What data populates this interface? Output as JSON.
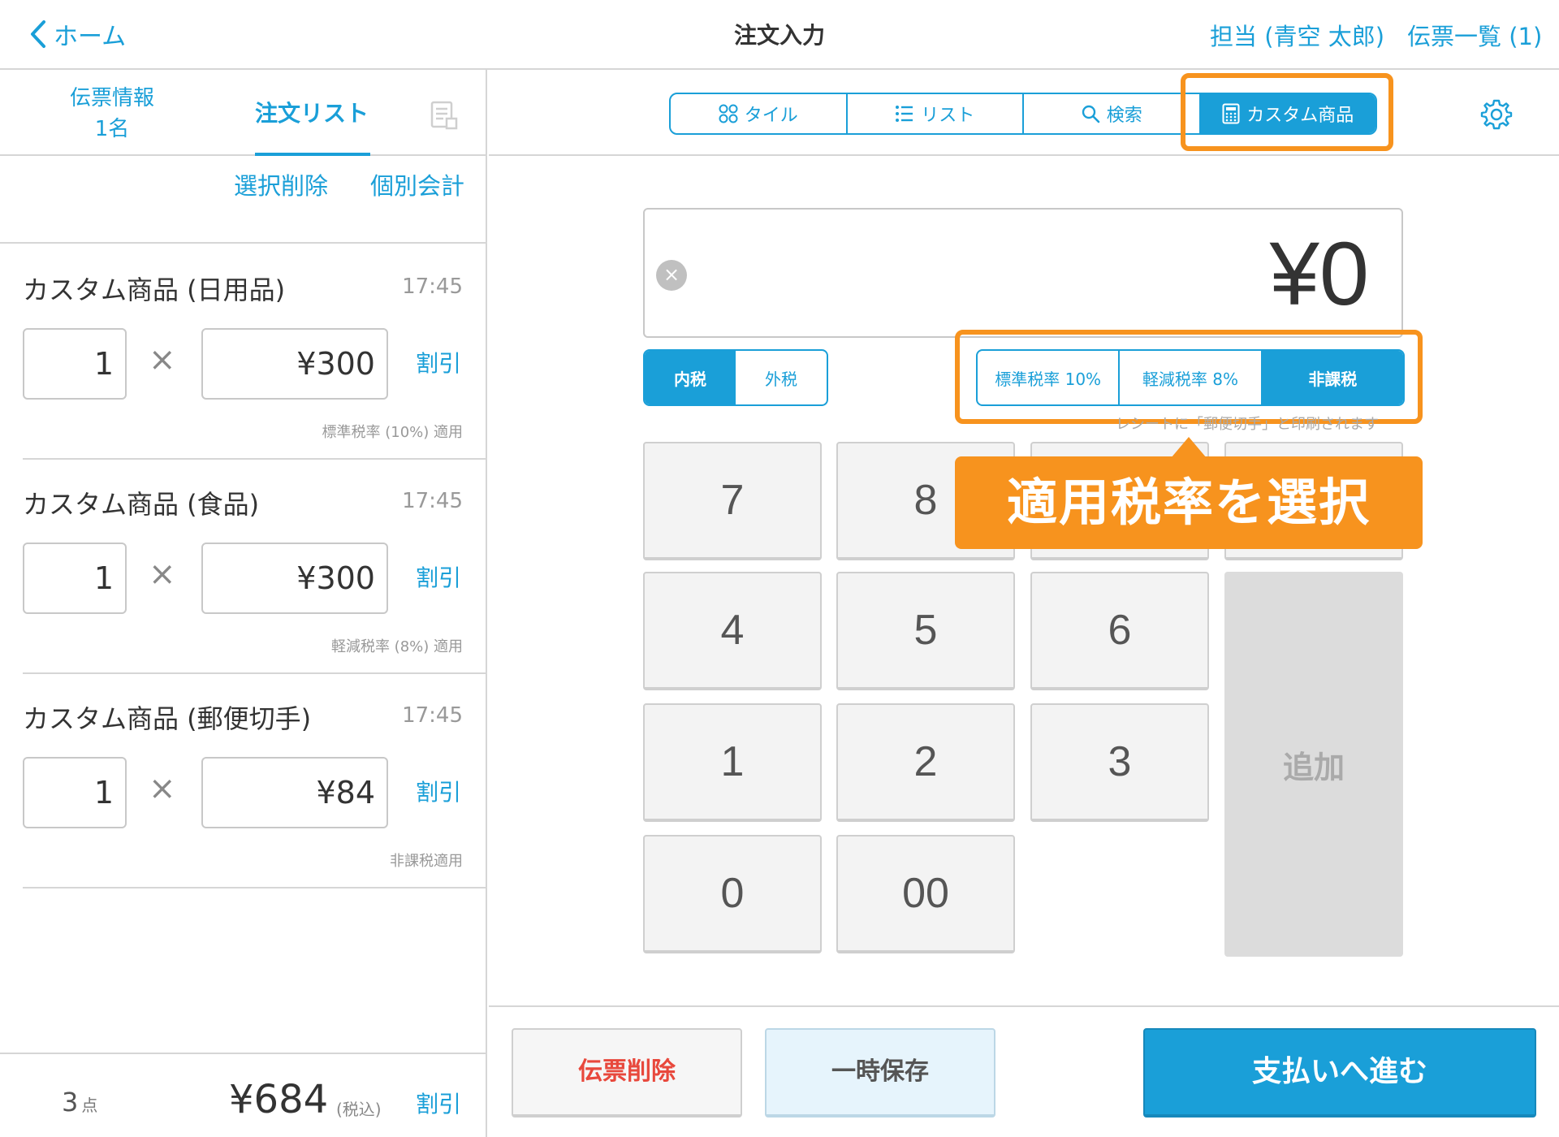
{
  "header": {
    "back_label": "ホーム",
    "title": "注文入力",
    "staff_label": "担当 (青空 太郎)",
    "slips_label": "伝票一覧 (1)"
  },
  "left_tabs": {
    "slip_info_line1": "伝票情報",
    "slip_info_line2": "1名",
    "order_list": "注文リスト"
  },
  "actions": {
    "select_delete": "選択削除",
    "individual_pay": "個別会計"
  },
  "orders": [
    {
      "name": "カスタム商品 (日用品)",
      "time": "17:45",
      "qty": "1",
      "price": "¥300",
      "discount": "割引",
      "tax_note": "標準税率 (10%) 適用"
    },
    {
      "name": "カスタム商品 (食品)",
      "time": "17:45",
      "qty": "1",
      "price": "¥300",
      "discount": "割引",
      "tax_note": "軽減税率 (8%) 適用"
    },
    {
      "name": "カスタム商品 (郵便切手)",
      "time": "17:45",
      "qty": "1",
      "price": "¥84",
      "discount": "割引",
      "tax_note": "非課税適用"
    }
  ],
  "footer": {
    "count": "3",
    "count_unit": "点",
    "total": "¥684",
    "tax_included": "(税込)",
    "discount": "割引"
  },
  "view_modes": {
    "tile": "タイル",
    "list": "リスト",
    "search": "検索",
    "custom": "カスタム商品",
    "active": "custom"
  },
  "amount": "¥0",
  "tax_mode": {
    "inclusive": "内税",
    "exclusive": "外税",
    "active": "inclusive"
  },
  "tax_rate": {
    "standard": "標準税率 10%",
    "reduced": "軽減税率 8%",
    "exempt": "非課税",
    "active": "exempt"
  },
  "receipt_note": "レシートに「郵便切手」と印刷されます",
  "keypad": {
    "k7": "7",
    "k8": "8",
    "k4": "4",
    "k5": "5",
    "k6": "6",
    "k1": "1",
    "k2": "2",
    "k3": "3",
    "k0": "0",
    "k00": "00",
    "add": "追加"
  },
  "callout": "適用税率を選択",
  "bottom": {
    "delete_slip": "伝票削除",
    "temp_save": "一時保存",
    "proceed_pay": "支払いへ進む"
  },
  "colors": {
    "accent": "#1a9fd8",
    "highlight": "#f7931e",
    "danger": "#e8483c"
  }
}
